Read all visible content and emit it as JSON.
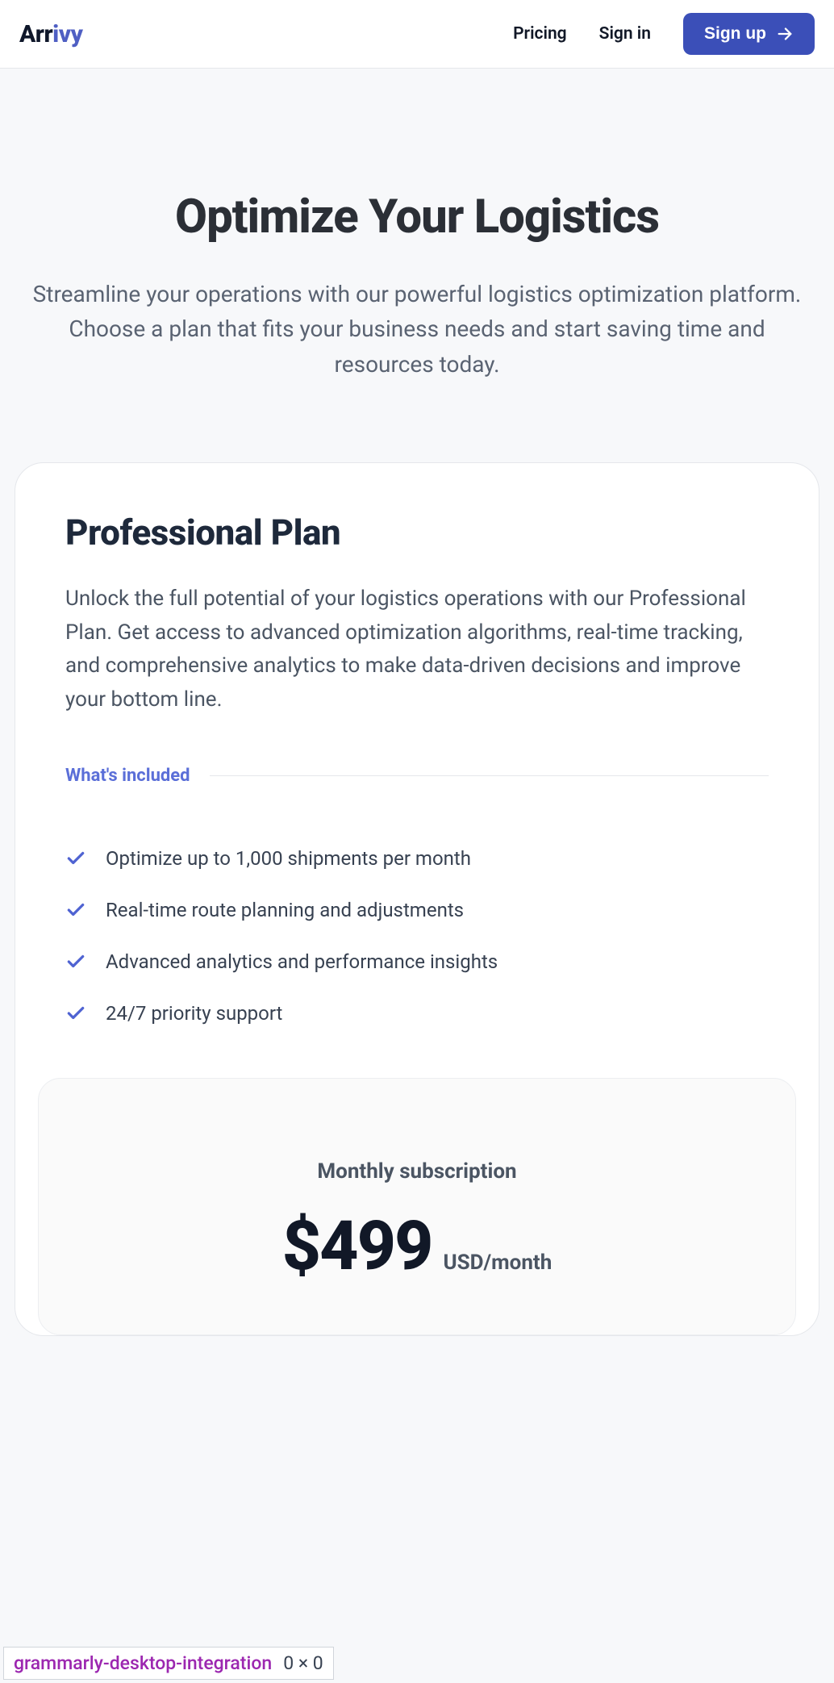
{
  "logo": {
    "part1": "Arr",
    "part2": "ivy"
  },
  "nav": {
    "pricing": "Pricing",
    "signin": "Sign in",
    "signup": "Sign up"
  },
  "hero": {
    "title": "Optimize Your Logistics",
    "subtitle": "Streamline your operations with our powerful logistics optimization platform. Choose a plan that fits your business needs and start saving time and resources today."
  },
  "plan": {
    "title": "Professional Plan",
    "desc": "Unlock the full potential of your logistics operations with our Professional Plan. Get access to advanced optimization algorithms, real-time tracking, and comprehensive analytics to make data-driven decisions and improve your bottom line.",
    "included_label": "What's included",
    "features": [
      "Optimize up to 1,000 shipments per month",
      "Real-time route planning and adjustments",
      "Advanced analytics and performance insights",
      "24/7 priority support"
    ],
    "price": {
      "label": "Monthly subscription",
      "amount": "$499",
      "unit": "USD/month"
    }
  },
  "overlay": {
    "name": "grammarly-desktop-integration",
    "dims": "0 × 0"
  }
}
